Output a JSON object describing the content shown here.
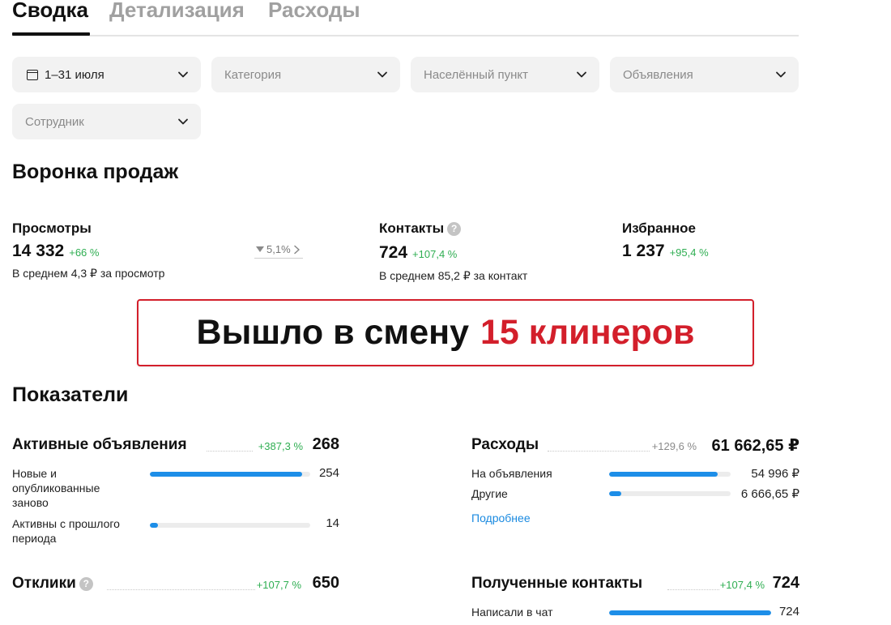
{
  "tabs": [
    {
      "label": "Сводка"
    },
    {
      "label": "Детализация"
    },
    {
      "label": "Расходы"
    }
  ],
  "filters": {
    "period": "1–31 июля",
    "category": "Категория",
    "locality": "Населённый пункт",
    "ads": "Объявления",
    "employee": "Сотрудник"
  },
  "funnel": {
    "title": "Воронка продаж",
    "views": {
      "title": "Просмотры",
      "value": "14 332",
      "delta": "+66 %",
      "sub": "В среднем 4,3 ₽ за просмотр"
    },
    "conversion": "5,1%",
    "contacts": {
      "title": "Контакты",
      "value": "724",
      "delta": "+107,4 %",
      "sub": "В среднем 85,2 ₽ за контакт"
    },
    "favorites": {
      "title": "Избранное",
      "value": "1 237",
      "delta": "+95,4 %"
    }
  },
  "banner": {
    "text": "Вышло в смену",
    "highlight": "15 клинеров"
  },
  "indicators": {
    "title": "Показатели",
    "active_ads": {
      "title": "Активные объявления",
      "delta": "+387,3 %",
      "value": "268",
      "rows": [
        {
          "label": "Новые и опубликованные заново",
          "value": "254",
          "fraction": 0.95
        },
        {
          "label": "Активны с прошлого периода",
          "value": "14",
          "fraction": 0.05
        }
      ]
    },
    "expenses": {
      "title": "Расходы",
      "delta": "+129,6 %",
      "value": "61 662,65 ₽",
      "rows": [
        {
          "label": "На объявления",
          "value": "54 996 ₽",
          "fraction": 0.89
        },
        {
          "label": "Другие",
          "value": "6 666,65 ₽",
          "fraction": 0.1
        }
      ],
      "link": "Подробнее"
    },
    "responses": {
      "title": "Отклики",
      "delta": "+107,7 %",
      "value": "650"
    },
    "received_contacts": {
      "title": "Полученные контакты",
      "delta": "+107,4 %",
      "value": "724",
      "rows": [
        {
          "label": "Написали в чат",
          "value": "724",
          "fraction": 1.0
        }
      ]
    }
  },
  "colors": {
    "accent": "#1d8ee8",
    "positive": "#2fae52",
    "banner_red": "#d31f2b"
  }
}
